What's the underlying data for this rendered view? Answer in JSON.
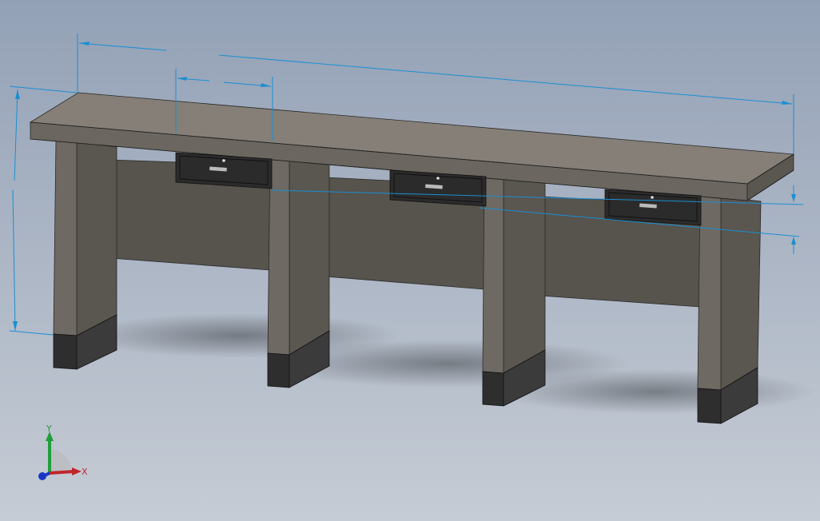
{
  "viewport": {
    "background_top": "#93a1b6",
    "background_bottom": "#c6ccd5"
  },
  "model": {
    "colors": {
      "top_face": "#857f77",
      "front_face": "#6b665f",
      "leg_front": "#6e6962",
      "leg_side": "#5a5650",
      "panel": "#57534d",
      "foot": "#2e2e2e",
      "drawer": "#2b2b2b",
      "dimension_line": "#1a8fd1"
    }
  },
  "triad": {
    "x_label": "X",
    "y_label": "Y",
    "x_color": "#c0262c",
    "y_color": "#1f9e3a",
    "z_color": "#1a36c4"
  }
}
